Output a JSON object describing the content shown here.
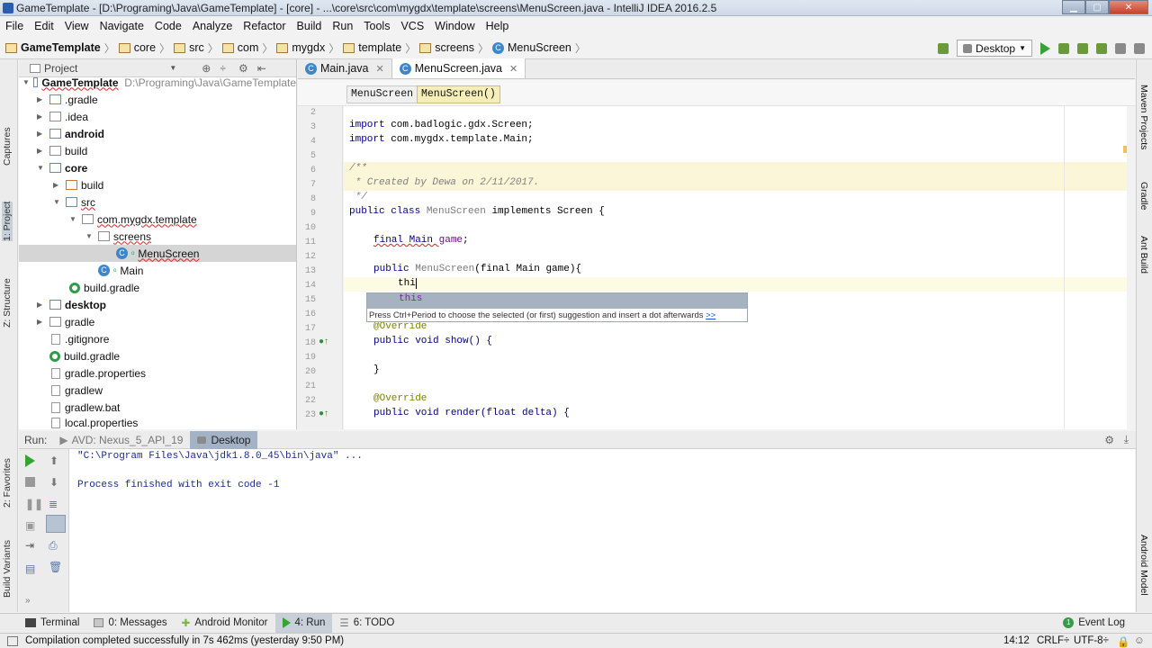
{
  "window": {
    "title": "GameTemplate - [D:\\Programing\\Java\\GameTemplate] - [core] - ...\\core\\src\\com\\mygdx\\template\\screens\\MenuScreen.java - IntelliJ IDEA 2016.2.5"
  },
  "menu": [
    "File",
    "Edit",
    "View",
    "Navigate",
    "Code",
    "Analyze",
    "Refactor",
    "Build",
    "Run",
    "Tools",
    "VCS",
    "Window",
    "Help"
  ],
  "breadcrumbs": [
    "GameTemplate",
    "core",
    "src",
    "com",
    "mygdx",
    "template",
    "screens",
    "MenuScreen"
  ],
  "toolbar": {
    "run_config": "Desktop"
  },
  "left_stripe": {
    "captures": "Captures",
    "project": "1: Project",
    "structure": "Z: Structure",
    "favorites": "2: Favorites",
    "build_variants": "Build Variants"
  },
  "project_panel": {
    "header": "Project",
    "root_name": "GameTemplate",
    "root_path": "D:\\Programing\\Java\\GameTemplate",
    "items": [
      ".gradle",
      ".idea",
      "android",
      "build",
      "core",
      "build",
      "src",
      "com.mygdx.template",
      "screens",
      "MenuScreen",
      "Main",
      "build.gradle",
      "desktop",
      "gradle",
      ".gitignore",
      "build.gradle",
      "gradle.properties",
      "gradlew",
      "gradlew.bat",
      "local.properties"
    ]
  },
  "editor": {
    "tabs": [
      "Main.java",
      "MenuScreen.java"
    ],
    "breadcrumb_chips": [
      "MenuScreen",
      "MenuScreen()"
    ],
    "line_numbers": [
      "2",
      "3",
      "4",
      "5",
      "6",
      "7",
      "8",
      "9",
      "10",
      "11",
      "12",
      "13",
      "14",
      "15",
      "16",
      "17",
      "18",
      "19",
      "20",
      "21",
      "22",
      "23"
    ],
    "code": {
      "l3_kw": "import",
      "l3": " com.badlogic.gdx.Screen;",
      "l4_kw": "import",
      "l4": " com.mygdx.template.Main;",
      "l6": "/**",
      "l7": " * Created by Dewa on 2/11/2017.",
      "l8": " */",
      "l9_a": "public class ",
      "l9_b": "MenuScreen",
      "l9_c": " implements Screen {",
      "l11_a": "final Main ",
      "l11_b": "game",
      ";": ";",
      "l13_a": "public ",
      "l13_b": "MenuScreen",
      "l13_c": "(final Main game){",
      "l14": "thi",
      "l17": "@Override",
      "l18": "public void show() {",
      "l20": "}",
      "l22": "@Override",
      "l23": "public void render(float delta) {"
    },
    "completion": {
      "suggestion": "this",
      "hint": "Press Ctrl+Period to choose the selected (or first) suggestion and insert a dot afterwards",
      "hint_link": ">>"
    }
  },
  "right_stripe": {
    "maven": "Maven Projects",
    "gradle": "Gradle",
    "ant": "Ant Build",
    "android_model": "Android Model"
  },
  "run_panel": {
    "label": "Run:",
    "tabs": [
      "AVD: Nexus_5_API_19",
      "Desktop"
    ],
    "console": [
      "\"C:\\Program Files\\Java\\jdk1.8.0_45\\bin\\java\" ...",
      "Process finished with exit code -1"
    ]
  },
  "tool_tabs": [
    {
      "label": "Terminal"
    },
    {
      "label": "0: Messages"
    },
    {
      "label": "Android Monitor"
    },
    {
      "label": "4: Run"
    },
    {
      "label": "6: TODO"
    }
  ],
  "event_log": "Event Log",
  "status": {
    "message": "Compilation completed successfully in 7s 462ms (yesterday 9:50 PM)",
    "position": "14:12",
    "line_sep": "CRLF÷",
    "encoding": "UTF-8÷"
  }
}
